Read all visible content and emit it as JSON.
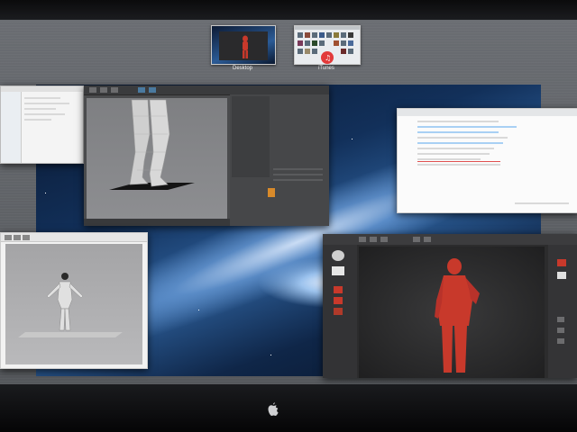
{
  "mission_control": {
    "spaces": [
      {
        "label": "Desktop",
        "kind": "desktop-space"
      },
      {
        "label": "iTunes",
        "kind": "fullscreen-app-space"
      }
    ]
  },
  "windows": {
    "cinema4d": {
      "icon": "3d-viewport-icon"
    },
    "finder": {
      "icon": "finder-icon"
    },
    "itunes": {
      "icon": "itunes-icon"
    },
    "model_editor": {
      "icon": "model-editor-icon"
    },
    "zbrush": {
      "icon": "sculpt-brush-icon"
    }
  },
  "colors": {
    "wallpaper_blue": "#12305a",
    "zbrush_clay": "#c8392b",
    "itunes_highlight": "#a8d0f4",
    "itunes_selected_red": "#e05050"
  },
  "hardware": {
    "logo": "apple-logo-icon"
  }
}
